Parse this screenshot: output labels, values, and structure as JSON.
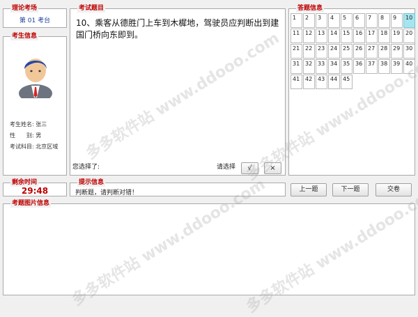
{
  "room": {
    "title": "理论考场",
    "number": "第 01 考台"
  },
  "candidate": {
    "title": "考生信息",
    "name_label": "考生姓名:",
    "name": "张三",
    "gender_label": "性　　别:",
    "gender": "男",
    "subject_label": "考试科目:",
    "subject": "北京区域"
  },
  "question": {
    "title": "考试题目",
    "text": "10、乘客从德胜门上车到木樨地，驾驶员应判断出到建国门桥向东即到。",
    "you_chose_label": "您选择了:",
    "please_choose_label": "请选择",
    "true_label": "√",
    "false_label": "×"
  },
  "answers": {
    "title": "答题信息",
    "numbers": [
      "1",
      "2",
      "3",
      "4",
      "5",
      "6",
      "7",
      "8",
      "9",
      "10",
      "11",
      "12",
      "13",
      "14",
      "15",
      "16",
      "17",
      "18",
      "19",
      "20",
      "21",
      "22",
      "23",
      "24",
      "25",
      "26",
      "27",
      "28",
      "29",
      "30",
      "31",
      "32",
      "33",
      "34",
      "35",
      "36",
      "37",
      "38",
      "39",
      "40",
      "41",
      "42",
      "43",
      "44",
      "45"
    ],
    "current": "10"
  },
  "time": {
    "title": "剩余时间",
    "value": "29:48"
  },
  "hint": {
    "title": "提示信息",
    "text": "判断题，请判断对错！"
  },
  "nav": {
    "prev_label": "上一题",
    "next_label": "下一题",
    "submit_label": "交卷"
  },
  "image_info": {
    "title": "考题图片信息"
  },
  "watermark": {
    "text": "多多软件站  www.ddooo.com"
  },
  "colors": {
    "title_red": "#c00000",
    "room_blue": "#1f3f9f",
    "current_cell": "#a6e5f0"
  }
}
